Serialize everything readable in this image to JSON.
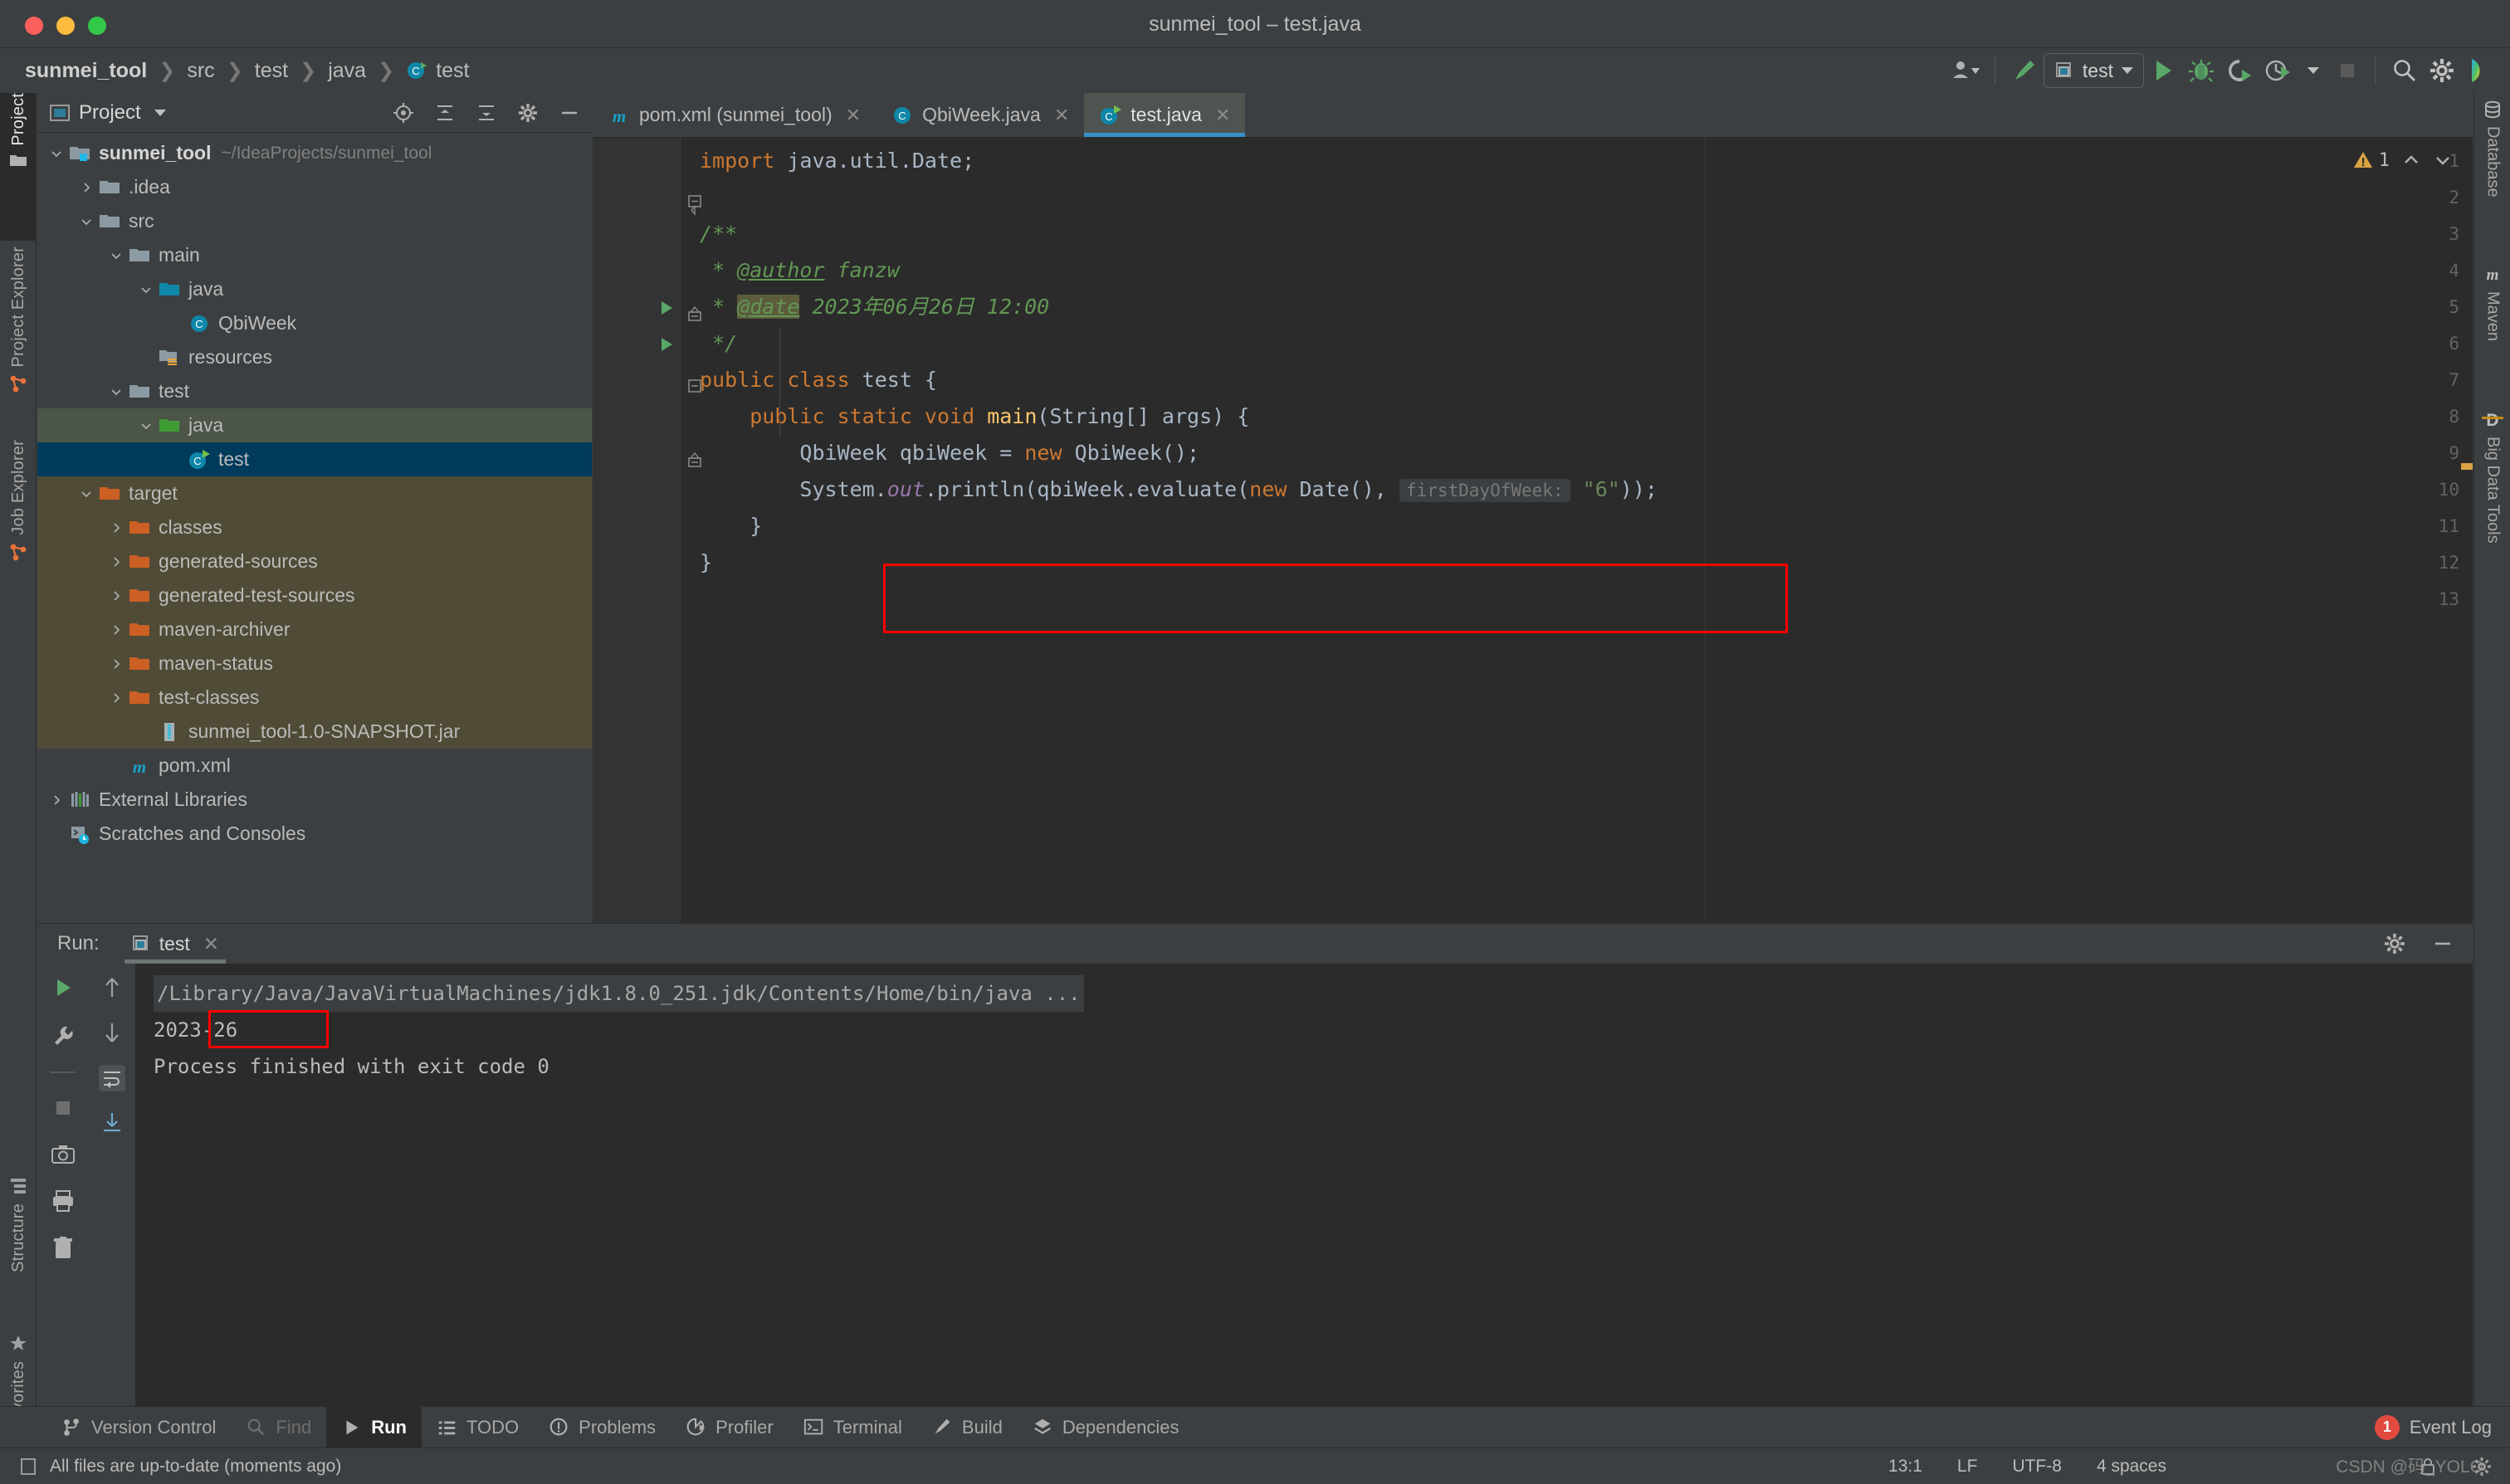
{
  "window": {
    "title": "sunmei_tool – test.java"
  },
  "breadcrumb": {
    "items": [
      {
        "label": "sunmei_tool",
        "icon": "none"
      },
      {
        "label": "src",
        "icon": "none"
      },
      {
        "label": "test",
        "icon": "none"
      },
      {
        "label": "java",
        "icon": "none"
      },
      {
        "label": "test",
        "icon": "java-class-icon"
      }
    ]
  },
  "toolbar": {
    "account_icon": "user-icon",
    "build_icon": "build-hammer-icon",
    "run_config": "test",
    "run_icon": "run-icon",
    "debug_icon": "debug-icon",
    "run_coverage_icon": "run-with-coverage-icon",
    "profile_icon": "profiler-icon",
    "stop_icon": "stop-icon",
    "search_icon": "search-icon",
    "settings_icon": "gear-icon",
    "ide_icon": "ide-logo-icon"
  },
  "left_strip": {
    "tabs": [
      {
        "label": "Project",
        "icon": "project-folder-icon",
        "active": true
      },
      {
        "label": "Project Explorer",
        "icon": "branch-icon",
        "active": false
      },
      {
        "label": "Job Explorer",
        "icon": "branch-icon",
        "active": false
      },
      {
        "label": "Structure",
        "icon": "structure-icon",
        "active": false
      },
      {
        "label": "Favorites",
        "icon": "star-icon",
        "active": false
      }
    ]
  },
  "right_strip": {
    "tabs": [
      {
        "label": "Database",
        "icon": "database-icon"
      },
      {
        "label": "Maven",
        "icon": "maven-m-icon"
      },
      {
        "label": "Big Data Tools",
        "icon": "big-data-d-icon"
      }
    ]
  },
  "project_panel": {
    "title": "Project",
    "header_icons": [
      "target-icon",
      "collapse-all-icon",
      "expand-all-icon",
      "gear-icon",
      "hide-icon"
    ],
    "tree": [
      {
        "indent": 0,
        "arrow": "down",
        "icon": "module-folder-icon",
        "label": "sunmei_tool",
        "bold": true,
        "path": "~/IdeaProjects/sunmei_tool",
        "state": "normal"
      },
      {
        "indent": 1,
        "arrow": "right",
        "icon": "folder-icon",
        "label": ".idea",
        "bold": false,
        "path": "",
        "state": "normal"
      },
      {
        "indent": 1,
        "arrow": "down",
        "icon": "folder-icon",
        "label": "src",
        "bold": false,
        "path": "",
        "state": "normal"
      },
      {
        "indent": 2,
        "arrow": "down",
        "icon": "folder-icon",
        "label": "main",
        "bold": false,
        "path": "",
        "state": "normal"
      },
      {
        "indent": 3,
        "arrow": "down",
        "icon": "source-folder-icon",
        "label": "java",
        "bold": false,
        "path": "",
        "state": "normal"
      },
      {
        "indent": 4,
        "arrow": "none",
        "icon": "java-class-icon",
        "label": "QbiWeek",
        "bold": false,
        "path": "",
        "state": "normal"
      },
      {
        "indent": 3,
        "arrow": "none",
        "icon": "resources-folder-icon",
        "label": "resources",
        "bold": false,
        "path": "",
        "state": "normal"
      },
      {
        "indent": 2,
        "arrow": "down",
        "icon": "folder-icon",
        "label": "test",
        "bold": false,
        "path": "",
        "state": "normal"
      },
      {
        "indent": 3,
        "arrow": "down",
        "icon": "test-source-folder-icon",
        "label": "java",
        "bold": false,
        "path": "",
        "state": "selected-green"
      },
      {
        "indent": 4,
        "arrow": "none",
        "icon": "java-runnable-class-icon",
        "label": "test",
        "bold": false,
        "path": "",
        "state": "selected-blue"
      },
      {
        "indent": 1,
        "arrow": "down",
        "icon": "excluded-folder-icon",
        "label": "target",
        "bold": false,
        "path": "",
        "state": "excluded"
      },
      {
        "indent": 2,
        "arrow": "right",
        "icon": "excluded-folder-icon",
        "label": "classes",
        "bold": false,
        "path": "",
        "state": "excluded"
      },
      {
        "indent": 2,
        "arrow": "right",
        "icon": "excluded-folder-icon",
        "label": "generated-sources",
        "bold": false,
        "path": "",
        "state": "excluded"
      },
      {
        "indent": 2,
        "arrow": "right",
        "icon": "excluded-folder-icon",
        "label": "generated-test-sources",
        "bold": false,
        "path": "",
        "state": "excluded"
      },
      {
        "indent": 2,
        "arrow": "right",
        "icon": "excluded-folder-icon",
        "label": "maven-archiver",
        "bold": false,
        "path": "",
        "state": "excluded"
      },
      {
        "indent": 2,
        "arrow": "right",
        "icon": "excluded-folder-icon",
        "label": "maven-status",
        "bold": false,
        "path": "",
        "state": "excluded"
      },
      {
        "indent": 2,
        "arrow": "right",
        "icon": "excluded-folder-icon",
        "label": "test-classes",
        "bold": false,
        "path": "",
        "state": "excluded"
      },
      {
        "indent": 3,
        "arrow": "none",
        "icon": "jar-icon",
        "label": "sunmei_tool-1.0-SNAPSHOT.jar",
        "bold": false,
        "path": "",
        "state": "excluded"
      },
      {
        "indent": 2,
        "arrow": "none",
        "icon": "maven-m-icon",
        "label": "pom.xml",
        "bold": false,
        "path": "",
        "state": "normal"
      },
      {
        "indent": 0,
        "arrow": "right",
        "icon": "libraries-icon",
        "label": "External Libraries",
        "bold": false,
        "path": "",
        "state": "normal"
      },
      {
        "indent": 0,
        "arrow": "none",
        "icon": "scratches-icon",
        "label": "Scratches and Consoles",
        "bold": false,
        "path": "",
        "state": "normal"
      }
    ]
  },
  "editor": {
    "tabs": [
      {
        "label": "pom.xml (sunmei_tool)",
        "icon": "maven-m-icon",
        "active": false
      },
      {
        "label": "QbiWeek.java",
        "icon": "java-class-icon",
        "active": false
      },
      {
        "label": "test.java",
        "icon": "java-runnable-class-icon",
        "active": true
      }
    ],
    "inspection": {
      "warn_count": "1",
      "warn_icon": "warning-triangle-icon"
    },
    "line_numbers": [
      "1",
      "2",
      "3",
      "4",
      "5",
      "6",
      "7",
      "8",
      "9",
      "10",
      "11",
      "12",
      "13"
    ],
    "code_lines": [
      {
        "n": 1,
        "tokens": [
          {
            "t": "import ",
            "c": "kw"
          },
          {
            "t": "java.util.Date;",
            "c": "txt"
          }
        ]
      },
      {
        "n": 2,
        "tokens": []
      },
      {
        "n": 3,
        "tokens": [
          {
            "t": "/**",
            "c": "cmt"
          }
        ]
      },
      {
        "n": 4,
        "tokens": [
          {
            "t": " * ",
            "c": "cmt"
          },
          {
            "t": "@author",
            "c": "tag"
          },
          {
            "t": " fanzw",
            "c": "cmt"
          }
        ]
      },
      {
        "n": 5,
        "tokens": [
          {
            "t": " * ",
            "c": "cmt"
          },
          {
            "t": "@date",
            "c": "tag-hl"
          },
          {
            "t": " 2023年06月26日 12:00",
            "c": "cmt"
          }
        ]
      },
      {
        "n": 6,
        "tokens": [
          {
            "t": " */",
            "c": "cmt"
          }
        ]
      },
      {
        "n": 7,
        "tokens": [
          {
            "t": "public class ",
            "c": "kw"
          },
          {
            "t": "test {",
            "c": "txt"
          }
        ]
      },
      {
        "n": 8,
        "tokens": [
          {
            "t": "    ",
            "c": "txt"
          },
          {
            "t": "public static void ",
            "c": "kw"
          },
          {
            "t": "main",
            "c": "fn"
          },
          {
            "t": "(String[] args) {",
            "c": "txt"
          }
        ]
      },
      {
        "n": 9,
        "tokens": [
          {
            "t": "        QbiWeek qbiWeek = ",
            "c": "txt"
          },
          {
            "t": "new ",
            "c": "kw"
          },
          {
            "t": "QbiWeek();",
            "c": "txt"
          }
        ]
      },
      {
        "n": 10,
        "tokens": [
          {
            "t": "        System.",
            "c": "txt"
          },
          {
            "t": "out",
            "c": "fld"
          },
          {
            "t": ".println(qbiWeek.evaluate(",
            "c": "txt"
          },
          {
            "t": "new ",
            "c": "kw"
          },
          {
            "t": "Date(), ",
            "c": "txt"
          },
          {
            "t": "firstDayOfWeek:",
            "c": "hint"
          },
          {
            "t": " ",
            "c": "txt"
          },
          {
            "t": "\"6\"",
            "c": "str"
          },
          {
            "t": "));",
            "c": "txt"
          }
        ]
      },
      {
        "n": 11,
        "tokens": [
          {
            "t": "    }",
            "c": "txt"
          }
        ]
      },
      {
        "n": 12,
        "tokens": [
          {
            "t": "}",
            "c": "txt"
          }
        ]
      },
      {
        "n": 13,
        "tokens": []
      }
    ],
    "run_markers": [
      7,
      8
    ],
    "highlight_box_label": "code-highlight-box"
  },
  "run_panel": {
    "label": "Run:",
    "tab": {
      "label": "test",
      "icon": "run-config-icon"
    },
    "header_icons": [
      "gear-icon",
      "hide-icon"
    ],
    "left_tools": [
      "rerun-icon",
      "wrench-icon",
      "stop-icon",
      "camera-icon",
      "print-icon",
      "trash-icon"
    ],
    "left_tools2": [
      "up-arrow-icon",
      "down-arrow-icon",
      "soft-wrap-icon",
      "scroll-to-end-icon"
    ],
    "console_lines": [
      {
        "text": "/Library/Java/JavaVirtualMachines/jdk1.8.0_251.jdk/Contents/Home/bin/java ...",
        "type": "cmd"
      },
      {
        "text": "2023-26",
        "type": "out-highlight"
      },
      {
        "text": "",
        "type": "out"
      },
      {
        "text": "Process finished with exit code 0",
        "type": "out"
      }
    ]
  },
  "tool_window_bar": {
    "items": [
      {
        "label": "Version Control",
        "icon": "branch-icon",
        "state": "normal"
      },
      {
        "label": "Find",
        "icon": "search-icon",
        "state": "dim"
      },
      {
        "label": "Run",
        "icon": "run-icon",
        "state": "active"
      },
      {
        "label": "TODO",
        "icon": "todo-list-icon",
        "state": "normal"
      },
      {
        "label": "Problems",
        "icon": "problems-icon",
        "state": "normal"
      },
      {
        "label": "Profiler",
        "icon": "profiler-icon",
        "state": "normal"
      },
      {
        "label": "Terminal",
        "icon": "terminal-icon",
        "state": "normal"
      },
      {
        "label": "Build",
        "icon": "build-hammer-icon",
        "state": "normal"
      },
      {
        "label": "Dependencies",
        "icon": "dependencies-icon",
        "state": "normal"
      }
    ],
    "event_log": {
      "label": "Event Log",
      "badge": "1"
    }
  },
  "status_bar": {
    "message": "All files are up-to-date (moments ago)",
    "message_icon": "file-icon",
    "caret_position": "13:1",
    "line_separator": "LF",
    "encoding": "UTF-8",
    "indent": "4 spaces",
    "watermark": "CSDN @码_YOLO",
    "lock_icon": "lock-icon",
    "gear_icon": "gear-icon"
  }
}
